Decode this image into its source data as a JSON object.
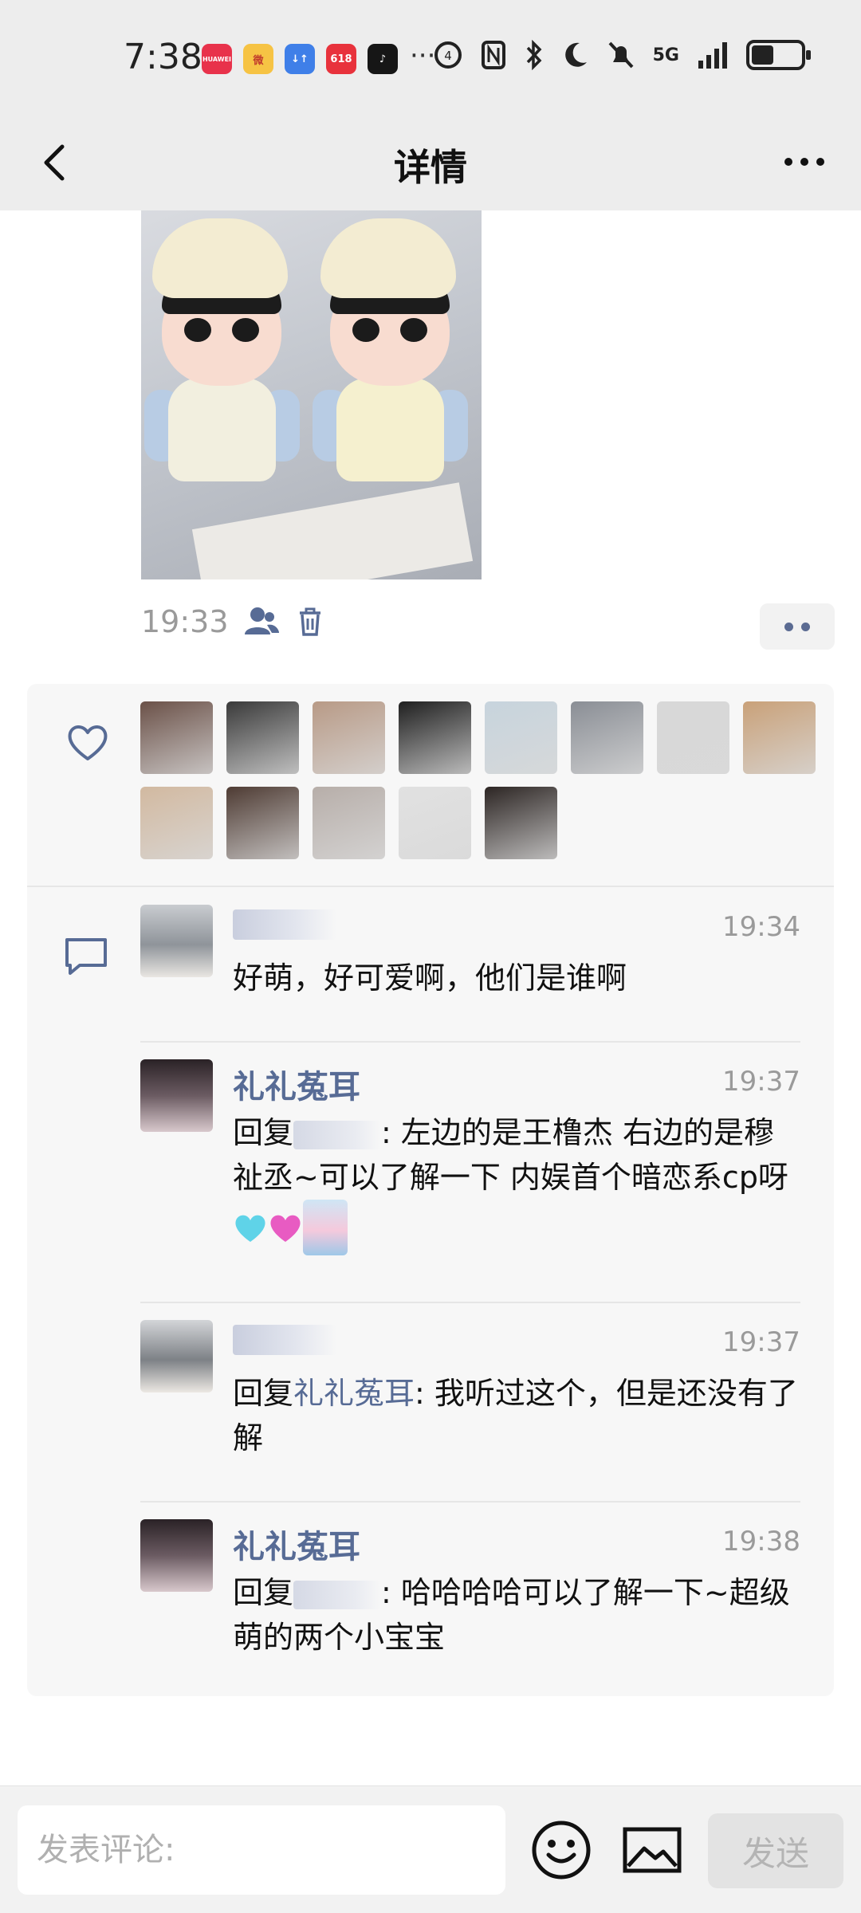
{
  "status_bar": {
    "time": "7:38",
    "app_icons": [
      {
        "name": "huawei-icon",
        "label": "HUAWEI",
        "color": "#e8324b"
      },
      {
        "name": "weibo-icon",
        "label": "微",
        "color": "#f6c344"
      },
      {
        "name": "sort-app-icon",
        "label": "↓↑",
        "color": "#3f7fe8"
      },
      {
        "name": "gift-app-icon",
        "label": "618",
        "color": "#e8323c"
      },
      {
        "name": "douyin-icon",
        "label": "♪",
        "color": "#161616"
      }
    ],
    "more_notifications": "···",
    "network": "5G",
    "battery_level": 0.45
  },
  "nav": {
    "title": "详情"
  },
  "post": {
    "time": "19:33",
    "visibility_icon": "person-icon",
    "delete_icon": "trash-icon"
  },
  "likes": {
    "icon": "heart-outline-icon",
    "avatars": [
      {
        "color": "#6b5148"
      },
      {
        "color": "#3a3a3a"
      },
      {
        "color": "#b89a86"
      },
      {
        "color": "#1f1f1f"
      },
      {
        "color": "#c7d4dd"
      },
      {
        "color": "#8a8e95"
      },
      {
        "color": "#d8d8d8"
      },
      {
        "color": "#c9a179"
      },
      {
        "color": "#d2b9a0"
      },
      {
        "color": "#4e3b33"
      },
      {
        "color": "#b7aea9"
      },
      {
        "color": "#e1e1e1"
      },
      {
        "color": "#2c2523"
      }
    ]
  },
  "comments": [
    {
      "name": "",
      "name_hidden": true,
      "time": "19:34",
      "text": "好萌，好可爱啊，他们是谁啊",
      "avatar_color": "#9fa3a8"
    },
    {
      "name": "礼礼菟耳",
      "time": "19:37",
      "reply_prefix": "回复",
      "text": ": 左边的是王橹杰 右边的是穆祉丞~可以了解一下 内娱首个暗恋系cp呀",
      "avatar_color": "#3b2e33"
    },
    {
      "name": "",
      "name_hidden": true,
      "time": "19:37",
      "reply_prefix": "回复",
      "reply_to": "礼礼菟耳",
      "text": ": 我听过这个，但是还没有了解",
      "avatar_color": "#a4a7ab"
    },
    {
      "name": "礼礼菟耳",
      "time": "19:38",
      "reply_prefix": "回复",
      "text": ": 哈哈哈哈可以了解一下~超级萌的两个小宝宝",
      "avatar_color": "#3b2e33"
    }
  ],
  "input": {
    "placeholder": "发表评论:",
    "value": ""
  },
  "buttons": {
    "send": "发送"
  },
  "colors": {
    "link_blue": "#576b95",
    "time_gray": "#9a9a9a",
    "header_bg": "#ededed"
  }
}
